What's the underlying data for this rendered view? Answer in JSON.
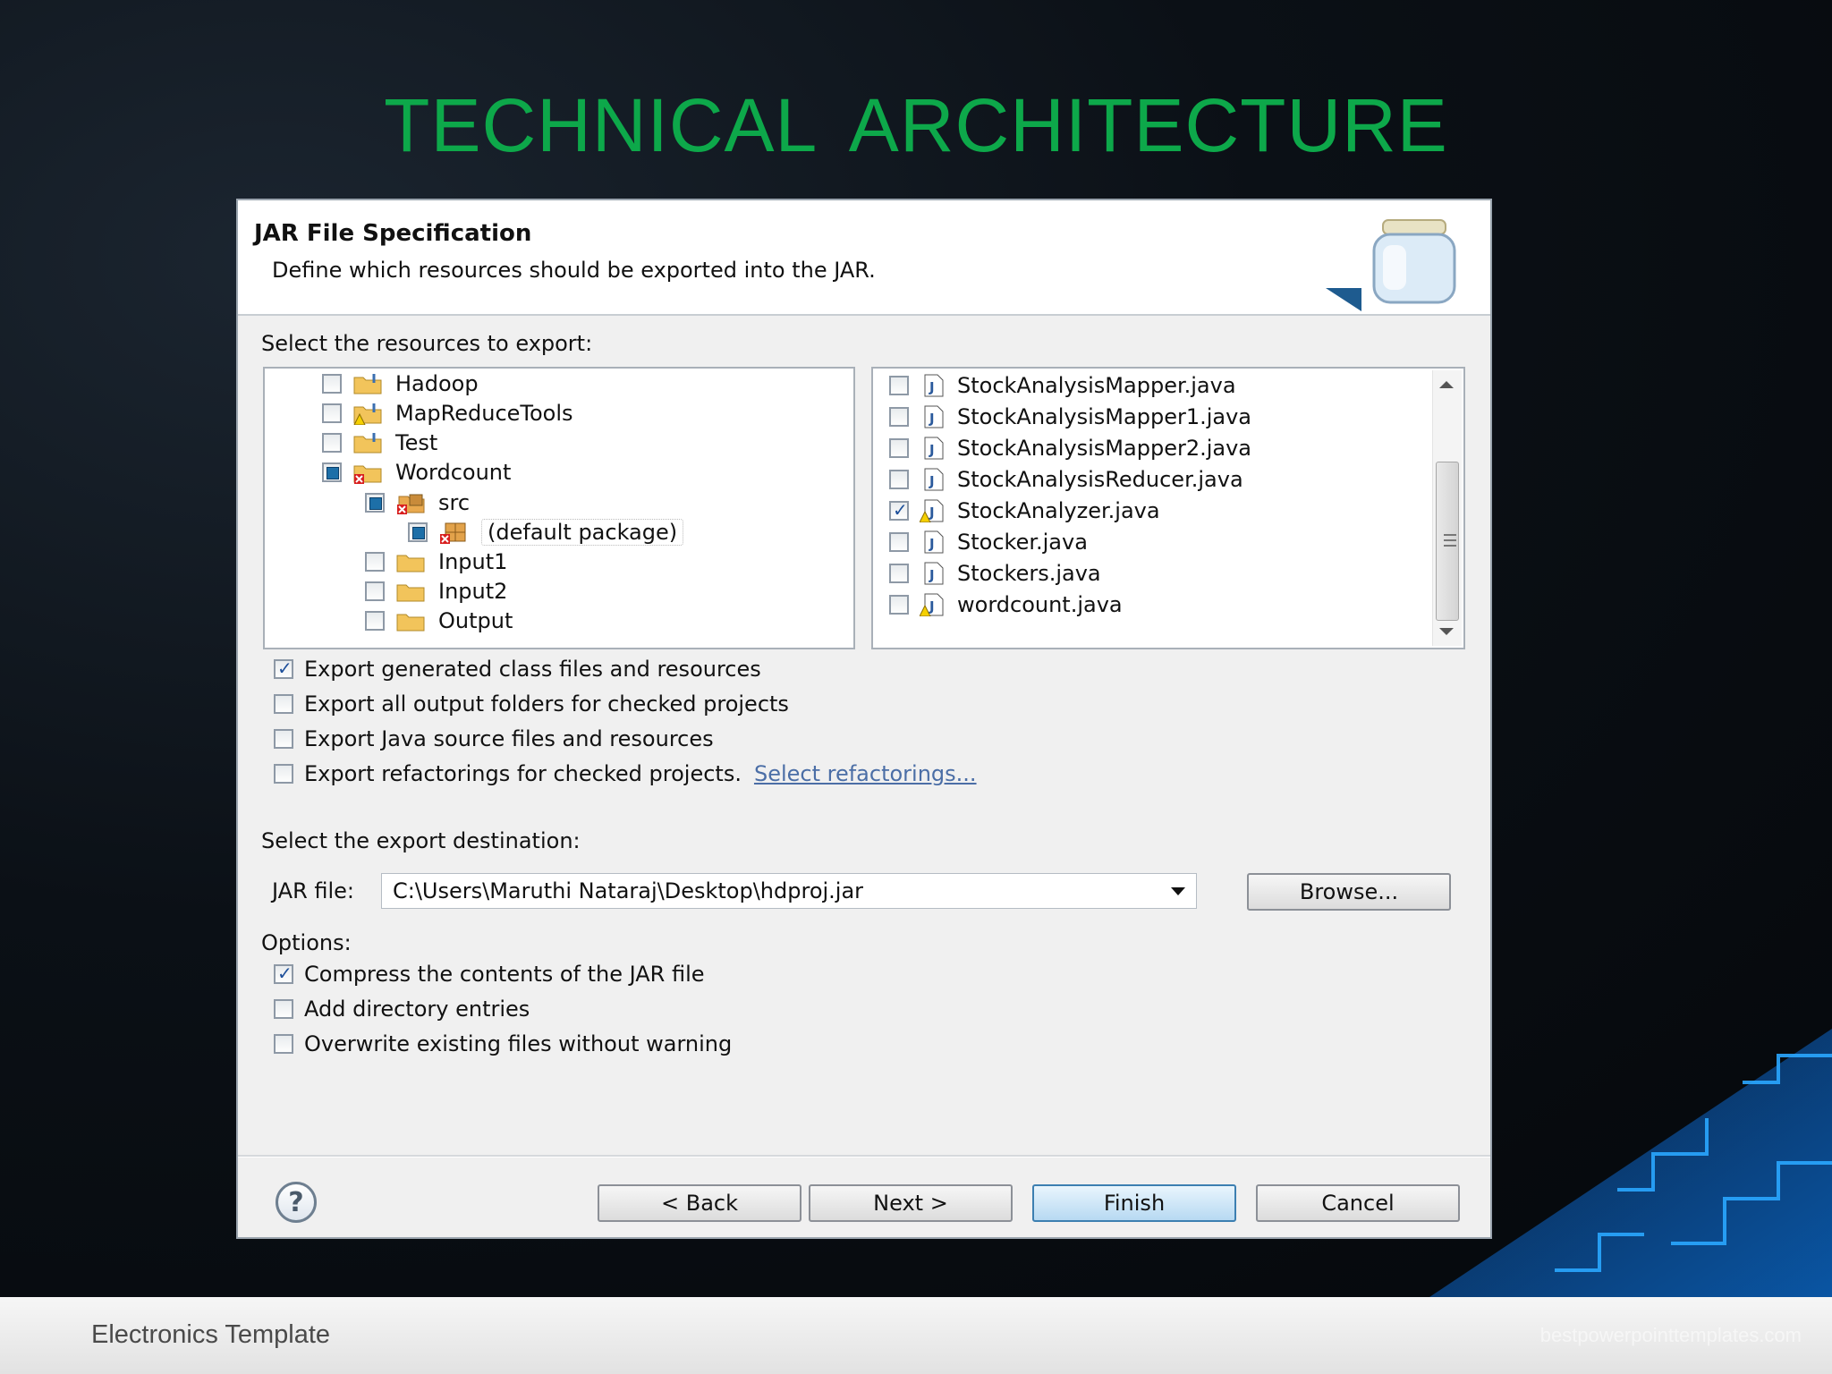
{
  "slide": {
    "title": "TECHNICAL  ARCHITECTURE",
    "footer_text": "Electronics Template",
    "footer_url": "bestpowerpointtemplates.com"
  },
  "dialog": {
    "title": "JAR File Specification",
    "description": "Define which resources should be exported into the JAR.",
    "resources_label": "Select the resources to export:",
    "tree": [
      {
        "label": "Hadoop",
        "state": "unchecked",
        "icon": "project-folder-icon"
      },
      {
        "label": "MapReduceTools",
        "state": "unchecked",
        "icon": "project-folder-warning-icon"
      },
      {
        "label": "Test",
        "state": "unchecked",
        "icon": "project-folder-icon"
      },
      {
        "label": "Wordcount",
        "state": "partial",
        "icon": "project-folder-error-icon"
      },
      {
        "label": "src",
        "state": "partial",
        "icon": "source-folder-error-icon"
      },
      {
        "label": "(default package)",
        "state": "partial",
        "icon": "package-error-icon"
      },
      {
        "label": "Input1",
        "state": "unchecked",
        "icon": "folder-icon"
      },
      {
        "label": "Input2",
        "state": "unchecked",
        "icon": "folder-icon"
      },
      {
        "label": "Output",
        "state": "unchecked",
        "icon": "folder-icon"
      }
    ],
    "files": [
      {
        "label": "StockAnalysisMapper.java",
        "checked": false,
        "icon": "java-file-icon"
      },
      {
        "label": "StockAnalysisMapper1.java",
        "checked": false,
        "icon": "java-file-icon"
      },
      {
        "label": "StockAnalysisMapper2.java",
        "checked": false,
        "icon": "java-file-icon"
      },
      {
        "label": "StockAnalysisReducer.java",
        "checked": false,
        "icon": "java-file-icon"
      },
      {
        "label": "StockAnalyzer.java",
        "checked": true,
        "icon": "java-file-warning-icon"
      },
      {
        "label": "Stocker.java",
        "checked": false,
        "icon": "java-file-icon"
      },
      {
        "label": "Stockers.java",
        "checked": false,
        "icon": "java-file-icon"
      },
      {
        "label": "wordcount.java",
        "checked": false,
        "icon": "java-file-warning-icon"
      }
    ],
    "export_options": [
      {
        "label": "Export generated class files and resources",
        "checked": true
      },
      {
        "label": "Export all output folders for checked projects",
        "checked": false
      },
      {
        "label": "Export Java source files and resources",
        "checked": false
      },
      {
        "label": "Export refactorings for checked projects.",
        "checked": false
      }
    ],
    "refactorings_link": "Select refactorings...",
    "destination_label": "Select the export destination:",
    "jar_file_label": "JAR file:",
    "jar_file_value": "C:\\Users\\Maruthi Nataraj\\Desktop\\hdproj.jar",
    "browse_label": "Browse...",
    "options_label": "Options:",
    "options": [
      {
        "label": "Compress the contents of the JAR file",
        "checked": true
      },
      {
        "label": "Add directory entries",
        "checked": false
      },
      {
        "label": "Overwrite existing files without warning",
        "checked": false
      }
    ],
    "help_glyph": "?",
    "buttons": {
      "back": "< Back",
      "next": "Next >",
      "finish": "Finish",
      "cancel": "Cancel"
    }
  },
  "colors": {
    "title_green": "#0da84a",
    "primary_button": "#b7d9f2",
    "link_blue": "#4b6ea6"
  }
}
